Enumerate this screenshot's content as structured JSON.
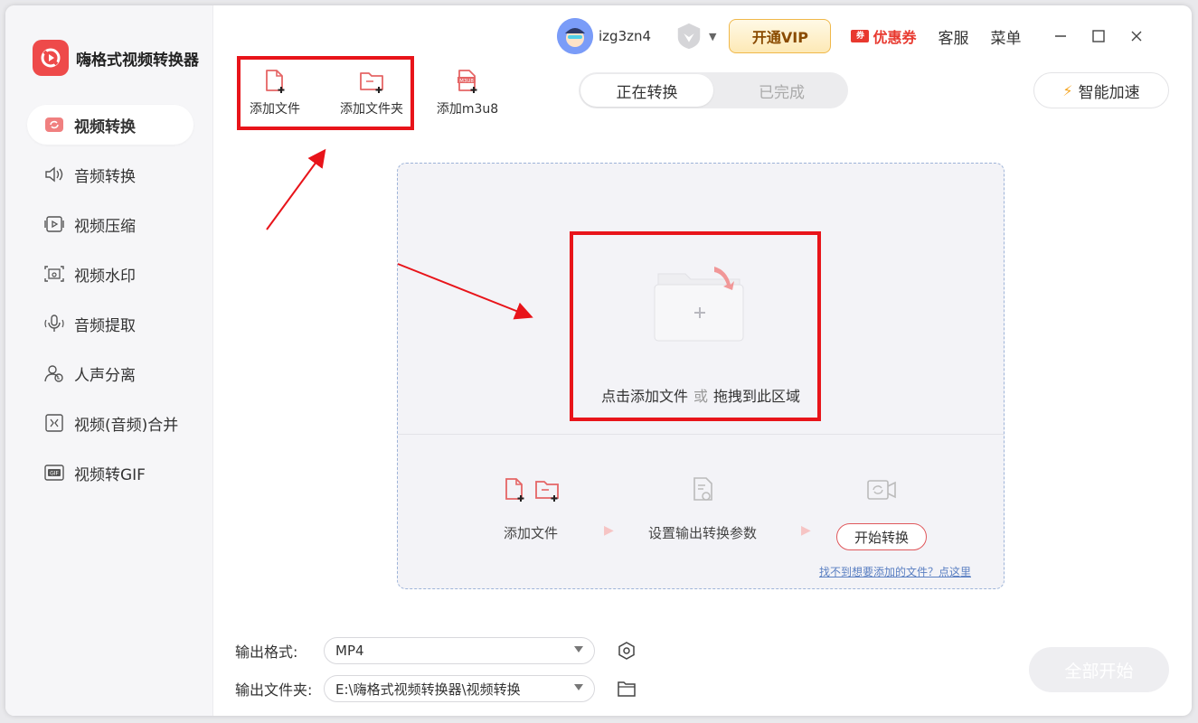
{
  "app": {
    "title": "嗨格式视频转换器"
  },
  "sidebar": {
    "items": [
      {
        "label": "视频转换",
        "icon": "video-convert-icon",
        "active": true
      },
      {
        "label": "音频转换",
        "icon": "audio-convert-icon",
        "active": false
      },
      {
        "label": "视频压缩",
        "icon": "video-compress-icon",
        "active": false
      },
      {
        "label": "视频水印",
        "icon": "video-watermark-icon",
        "active": false
      },
      {
        "label": "音频提取",
        "icon": "audio-extract-icon",
        "active": false
      },
      {
        "label": "人声分离",
        "icon": "vocal-separate-icon",
        "active": false
      },
      {
        "label": "视频(音频)合并",
        "icon": "merge-icon",
        "active": false
      },
      {
        "label": "视频转GIF",
        "icon": "gif-icon",
        "active": false
      }
    ]
  },
  "topbar": {
    "username": "izg3zn4",
    "vip_label": "开通VIP",
    "coupon_label": "优惠券",
    "coupon_tag": "券",
    "service_label": "客服",
    "menu_label": "菜单"
  },
  "toolbar": {
    "add_file": "添加文件",
    "add_folder": "添加文件夹",
    "add_m3u8": "添加m3u8",
    "m3u8_badge": "M3U8"
  },
  "tabs": {
    "converting": "正在转换",
    "done": "已完成"
  },
  "accelerate_label": "智能加速",
  "dropzone": {
    "click_text": "点击添加文件",
    "or_text": "或",
    "drag_text": "拖拽到此区域",
    "step1": "添加文件",
    "step2": "设置输出转换参数",
    "step3_button": "开始转换",
    "help_link": "找不到想要添加的文件？点这里"
  },
  "output": {
    "format_label": "输出格式:",
    "format_value": "MP4",
    "folder_label": "输出文件夹:",
    "folder_value": "E:\\嗨格式视频转换器\\视频转换"
  },
  "start_all_label": "全部开始",
  "colors": {
    "accent": "#ee4a4a",
    "highlight": "#e8141a",
    "vip_text": "#8a4b00"
  }
}
